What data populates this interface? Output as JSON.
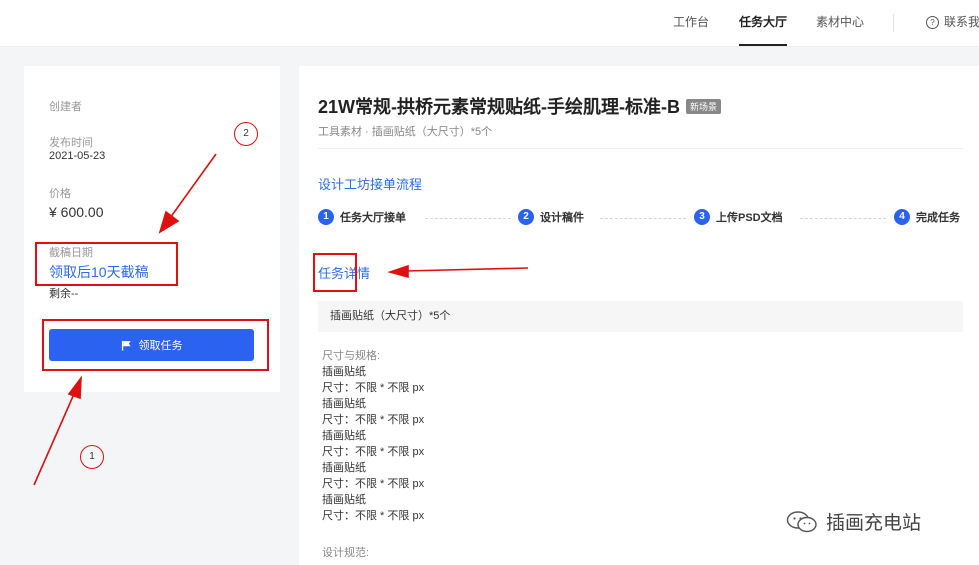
{
  "topnav": {
    "items": [
      "工作台",
      "任务大厅",
      "素材中心"
    ],
    "active": "任务大厅",
    "contact": "联系我"
  },
  "left": {
    "creator_label": "创建者",
    "publish_time_label": "发布时间",
    "publish_date": "2021-05-23",
    "price_label": "价格",
    "price": "¥ 600.00",
    "deadline_label": "截稿日期",
    "deadline_value": "领取后10天截稿",
    "remaining": "剩余--",
    "claim_button": "领取任务"
  },
  "task": {
    "title": "21W常规-拱桥元素常规贴纸-手绘肌理-标准-B",
    "badge": "新场景",
    "subtitle": "工具素材 · 插画贴纸（大尺寸）*5个",
    "flow_link": "设计工坊接单流程",
    "steps": [
      {
        "num": "1",
        "label": "任务大厅接单"
      },
      {
        "num": "2",
        "label": "设计稿件"
      },
      {
        "num": "3",
        "label": "上传PSD文档"
      },
      {
        "num": "4",
        "label": "完成任务"
      }
    ],
    "detail_heading": "任务详情",
    "detail_box": "插画贴纸（大尺寸）*5个",
    "spec_label": "尺寸与规格:",
    "spec_lines": [
      "插画贴纸",
      "尺寸：不限 * 不限 px",
      "插画贴纸",
      "尺寸：不限 * 不限 px",
      "插画贴纸",
      "尺寸：不限 * 不限 px",
      "插画贴纸",
      "尺寸：不限 * 不限 px",
      "插画贴纸",
      "尺寸：不限 * 不限 px"
    ],
    "design_label": "设计规范:"
  },
  "annotations": {
    "circle_1": "1",
    "circle_2": "2"
  },
  "watermark": "插画充电站",
  "colors": {
    "accent": "#2b62f0",
    "link": "#2d6cf0",
    "annotation": "#e01010"
  }
}
